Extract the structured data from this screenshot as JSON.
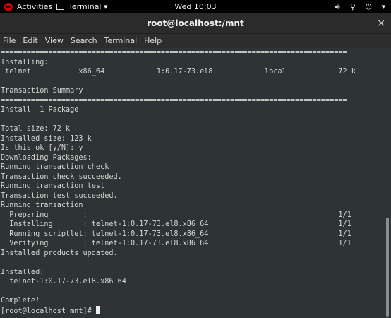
{
  "topbar": {
    "activities": "Activities",
    "app_menu": "Terminal ▾",
    "clock": "Wed 10:03",
    "volume_icon": "speaker-icon",
    "network_icon": "network-icon",
    "power_icon": "power-icon",
    "dropdown_icon": "▾"
  },
  "window": {
    "title": "root@localhost:/mnt",
    "close_label": "×"
  },
  "menubar": {
    "items": [
      "File",
      "Edit",
      "View",
      "Search",
      "Terminal",
      "Help"
    ]
  },
  "terminal": {
    "lines": [
      "================================================================================",
      "Installing:",
      " telnet           x86_64            1:0.17-73.el8            local            72 k",
      "",
      "Transaction Summary",
      "================================================================================",
      "Install  1 Package",
      "",
      "Total size: 72 k",
      "Installed size: 123 k",
      "Is this ok [y/N]: y",
      "Downloading Packages:",
      "Running transaction check",
      "Transaction check succeeded.",
      "Running transaction test",
      "Transaction test succeeded.",
      "Running transaction",
      "  Preparing        :                                                          1/1",
      "  Installing       : telnet-1:0.17-73.el8.x86_64                              1/1",
      "  Running scriptlet: telnet-1:0.17-73.el8.x86_64                              1/1",
      "  Verifying        : telnet-1:0.17-73.el8.x86_64                              1/1",
      "Installed products updated.",
      "",
      "Installed:",
      "  telnet-1:0.17-73.el8.x86_64",
      "",
      "Complete!"
    ],
    "prompt": "[root@localhost mnt]# "
  }
}
